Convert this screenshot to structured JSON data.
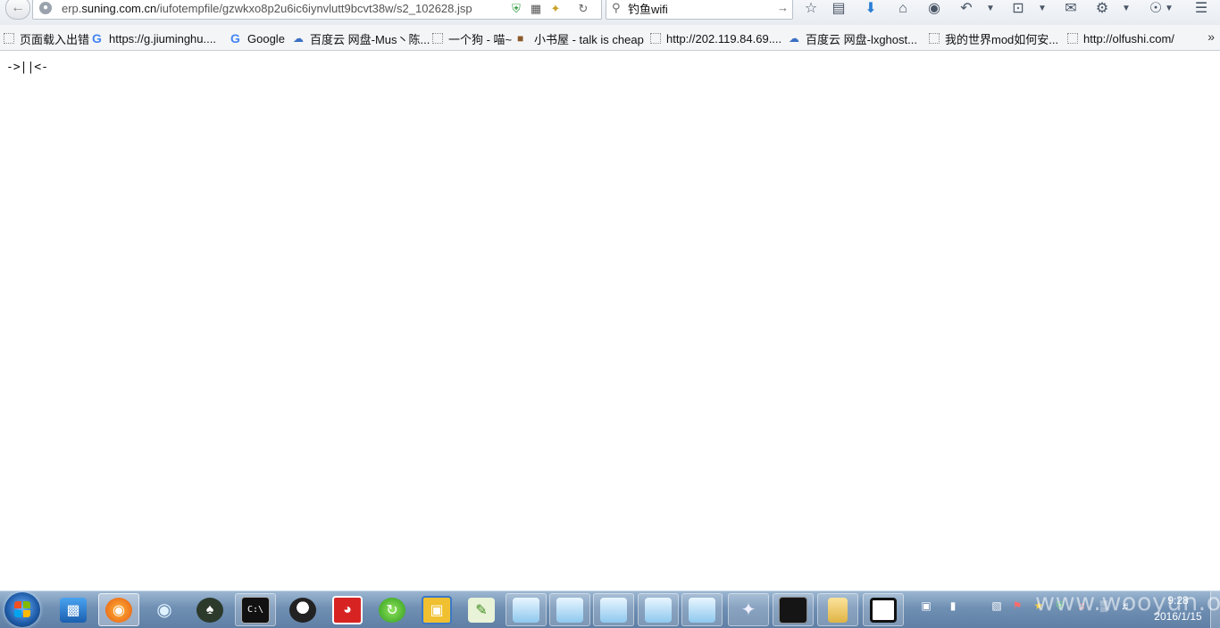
{
  "browser": {
    "url_prefix": "erp.",
    "url_host": "suning.com.cn",
    "url_path": "/iufotempfile/gzwkxo8p2u6ic6iynvlutt9bcvt38w/s2_102628.jsp",
    "search_value": "钓鱼wifi"
  },
  "bookmarks": [
    {
      "label": "页面载入出错",
      "icon": "blank-page-icon"
    },
    {
      "label": "https://g.jiuminghu....",
      "icon": "google-icon"
    },
    {
      "label": "Google",
      "icon": "google-icon"
    },
    {
      "label": "百度云 网盘-Mus丶陈...",
      "icon": "baidu-cloud-icon"
    },
    {
      "label": "一个狗 - 喵~",
      "icon": "blank-page-icon"
    },
    {
      "label": "小书屋 - talk is cheap",
      "icon": "house-icon"
    },
    {
      "label": "http://202.119.84.69....",
      "icon": "blank-page-icon"
    },
    {
      "label": "百度云 网盘-lxghost...",
      "icon": "baidu-cloud-icon"
    },
    {
      "label": "我的世界mod如何安...",
      "icon": "blank-page-icon"
    },
    {
      "label": "http://olfushi.com/",
      "icon": "blank-page-icon"
    }
  ],
  "page": {
    "body_text": "->||<-"
  },
  "taskbar": {
    "clock_time": "9:28",
    "clock_date": "2016/1/15",
    "watermark": "www.wooyun.org"
  },
  "colors": {
    "taskbar": "#6f8fb3",
    "bookmarks_bg": "#f4f5f7",
    "page_bg": "#ffffff"
  }
}
